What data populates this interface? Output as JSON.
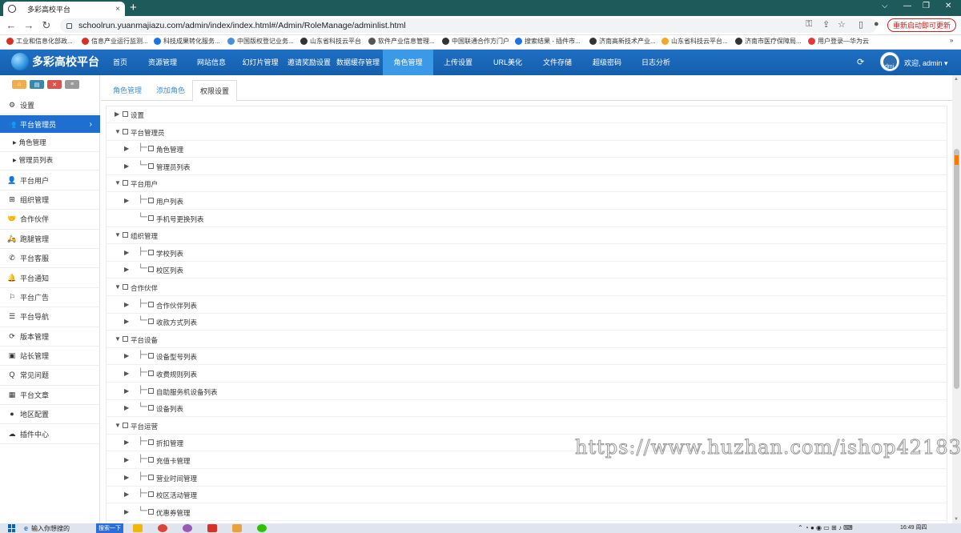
{
  "browser": {
    "tab_title": "多彩高校平台",
    "tab_close": "×",
    "new_tab": "+",
    "win_controls": [
      "⌵",
      "—",
      "❐",
      "✕"
    ],
    "url": "schoolrun.yuanmajiazu.com/admin/index/index.html#/Admin/RoleManage/adminlist.html",
    "restart_button": "重新启动即可更新",
    "nav": {
      "back": "←",
      "forward": "→",
      "reload": "↻"
    }
  },
  "bookmarks": [
    {
      "label": "工业和信息化部政...",
      "color": "#d93025"
    },
    {
      "label": "信息产业运行监测...",
      "color": "#d93025"
    },
    {
      "label": "科技成果转化服务...",
      "color": "#1a73e8"
    },
    {
      "label": "中国版权登记业务...",
      "color": "#4a90d9"
    },
    {
      "label": "山东省科技云平台",
      "color": "#333333"
    },
    {
      "label": "软件产业信息管理...",
      "color": "#555555"
    },
    {
      "label": "中国联通合作方门户",
      "color": "#333333"
    },
    {
      "label": "搜索结果 - 插件市...",
      "color": "#1a73e8"
    },
    {
      "label": "济南高新技术产业...",
      "color": "#333333"
    },
    {
      "label": "山东省科技云平台...",
      "color": "#f5a623"
    },
    {
      "label": "济南市医疗保障局...",
      "color": "#333333"
    },
    {
      "label": "用户登录—华为云",
      "color": "#e53935"
    }
  ],
  "app": {
    "logo_text": "多彩高校平台",
    "nav": [
      "首页",
      "资源管理",
      "网站信息",
      "幻灯片管理",
      "邀请奖励设置",
      "数据缓存管理",
      "角色管理",
      "上传设置",
      "URL美化",
      "文件存储",
      "超级密码",
      "日志分析"
    ],
    "active_nav": "角色管理",
    "avatar_text": "admi",
    "user_greeting": "欢迎, admin ▾"
  },
  "sidebar": {
    "items": [
      {
        "label": "设置",
        "icon": "gears-icon",
        "glyph": "⚙"
      },
      {
        "label": "平台管理员",
        "icon": "users-icon",
        "glyph": "👥",
        "active": true
      },
      {
        "label": "平台用户",
        "icon": "user-icon",
        "glyph": "👤"
      },
      {
        "label": "组织管理",
        "icon": "sitemap-icon",
        "glyph": "⊞"
      },
      {
        "label": "合作伙伴",
        "icon": "handshake-icon",
        "glyph": "🤝"
      },
      {
        "label": "跑腿管理",
        "icon": "motorcycle-icon",
        "glyph": "🛵"
      },
      {
        "label": "平台客服",
        "icon": "phone-icon",
        "glyph": "✆"
      },
      {
        "label": "平台通知",
        "icon": "bell-icon",
        "glyph": "🔔"
      },
      {
        "label": "平台广告",
        "icon": "flag-icon",
        "glyph": "⚐"
      },
      {
        "label": "平台导航",
        "icon": "list-icon",
        "glyph": "☰"
      },
      {
        "label": "版本管理",
        "icon": "refresh-icon",
        "glyph": "⟳"
      },
      {
        "label": "站长管理",
        "icon": "id-card-icon",
        "glyph": "▣"
      },
      {
        "label": "常见问题",
        "icon": "question-icon",
        "glyph": "Q"
      },
      {
        "label": "平台文章",
        "icon": "grid-icon",
        "glyph": "▦"
      },
      {
        "label": "地区配置",
        "icon": "map-marker-icon",
        "glyph": "●"
      },
      {
        "label": "插件中心",
        "icon": "cloud-icon",
        "glyph": "☁"
      }
    ],
    "subitems": [
      "角色管理",
      "管理员列表"
    ]
  },
  "content": {
    "tabs": [
      "角色管理",
      "添加角色",
      "权限设置"
    ],
    "active_tab": "权限设置",
    "tree": [
      {
        "label": "设置",
        "level": 0,
        "arrow": "▶"
      },
      {
        "label": "平台管理员",
        "level": 0,
        "arrow": "▼"
      },
      {
        "label": "角色管理",
        "level": 1,
        "arrow": "▶",
        "prefix": "├─"
      },
      {
        "label": "管理员列表",
        "level": 1,
        "arrow": "▶",
        "prefix": "└─"
      },
      {
        "label": "平台用户",
        "level": 0,
        "arrow": "▼"
      },
      {
        "label": "用户列表",
        "level": 1,
        "arrow": "▶",
        "prefix": "├─"
      },
      {
        "label": "手机号更换列表",
        "level": 1,
        "arrow": "",
        "prefix": "└─"
      },
      {
        "label": "组织管理",
        "level": 0,
        "arrow": "▼"
      },
      {
        "label": "学校列表",
        "level": 1,
        "arrow": "▶",
        "prefix": "├─"
      },
      {
        "label": "校区列表",
        "level": 1,
        "arrow": "▶",
        "prefix": "└─"
      },
      {
        "label": "合作伙伴",
        "level": 0,
        "arrow": "▼"
      },
      {
        "label": "合作伙伴列表",
        "level": 1,
        "arrow": "▶",
        "prefix": "├─"
      },
      {
        "label": "收款方式列表",
        "level": 1,
        "arrow": "▶",
        "prefix": "└─"
      },
      {
        "label": "平台设备",
        "level": 0,
        "arrow": "▼"
      },
      {
        "label": "设备型号列表",
        "level": 1,
        "arrow": "▶",
        "prefix": "├─"
      },
      {
        "label": "收费规则列表",
        "level": 1,
        "arrow": "▶",
        "prefix": "├─"
      },
      {
        "label": "自助服务机设备列表",
        "level": 1,
        "arrow": "▶",
        "prefix": "├─"
      },
      {
        "label": "设备列表",
        "level": 1,
        "arrow": "▶",
        "prefix": "└─"
      },
      {
        "label": "平台运营",
        "level": 0,
        "arrow": "▼"
      },
      {
        "label": "折扣管理",
        "level": 1,
        "arrow": "▶",
        "prefix": "├─"
      },
      {
        "label": "充值卡管理",
        "level": 1,
        "arrow": "▶",
        "prefix": "├─"
      },
      {
        "label": "营业时间管理",
        "level": 1,
        "arrow": "▶",
        "prefix": "├─"
      },
      {
        "label": "校区活动管理",
        "level": 1,
        "arrow": "▶",
        "prefix": "├─"
      },
      {
        "label": "优惠券管理",
        "level": 1,
        "arrow": "▶",
        "prefix": "└─"
      }
    ]
  },
  "watermark": "https://www.huzhan.com/ishop42183",
  "taskbar": {
    "search_placeholder": "输入你想搜的",
    "search_button": "搜索一下",
    "clock_time": "16:49 周四"
  }
}
